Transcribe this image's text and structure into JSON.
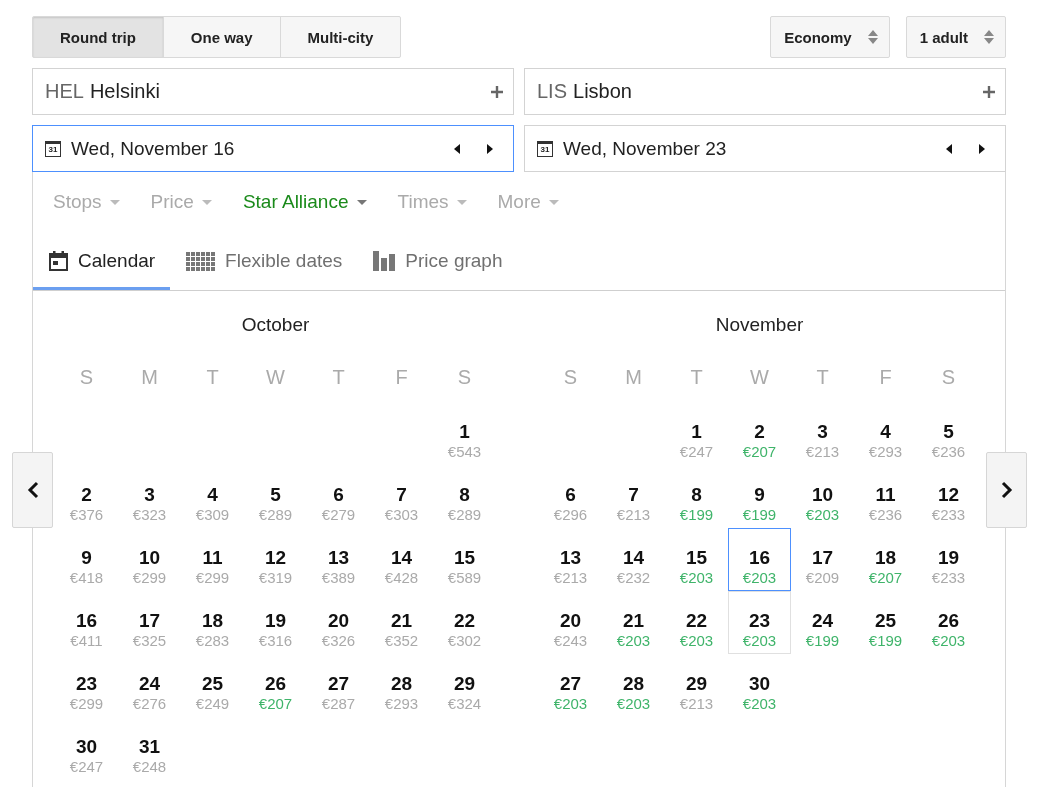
{
  "trip_types": [
    {
      "label": "Round trip",
      "selected": true
    },
    {
      "label": "One way",
      "selected": false
    },
    {
      "label": "Multi-city",
      "selected": false
    }
  ],
  "cabin": {
    "value": "Economy"
  },
  "passengers": {
    "value": "1 adult"
  },
  "origin": {
    "code": "HEL",
    "city": "Helsinki"
  },
  "destination": {
    "code": "LIS",
    "city": "Lisbon"
  },
  "dates": [
    {
      "icon_label": "31",
      "value": "Wed, November 16",
      "focused": true
    },
    {
      "icon_label": "31",
      "value": "Wed, November 23",
      "focused": false
    }
  ],
  "filters": [
    {
      "label": "Stops",
      "active": false
    },
    {
      "label": "Price",
      "active": false
    },
    {
      "label": "Star Alliance",
      "active": true
    },
    {
      "label": "Times",
      "active": false
    },
    {
      "label": "More",
      "active": false
    }
  ],
  "view_tabs": [
    {
      "label": "Calendar",
      "selected": true
    },
    {
      "label": "Flexible dates",
      "selected": false
    },
    {
      "label": "Price graph",
      "selected": false
    }
  ],
  "calendar": {
    "months": [
      {
        "name": "October",
        "weekdays": [
          "S",
          "M",
          "T",
          "W",
          "T",
          "F",
          "S"
        ],
        "weeks": [
          [
            {
              "day": "1",
              "price": "€543",
              "cheap": false,
              "selected": false,
              "return_date": false
            }
          ],
          [
            {
              "day": "2",
              "price": "€376",
              "cheap": false,
              "selected": false,
              "return_date": false
            },
            {
              "day": "3",
              "price": "€323",
              "cheap": false,
              "selected": false,
              "return_date": false
            },
            {
              "day": "4",
              "price": "€309",
              "cheap": false,
              "selected": false,
              "return_date": false
            },
            {
              "day": "5",
              "price": "€289",
              "cheap": false,
              "selected": false,
              "return_date": false
            },
            {
              "day": "6",
              "price": "€279",
              "cheap": false,
              "selected": false,
              "return_date": false
            },
            {
              "day": "7",
              "price": "€303",
              "cheap": false,
              "selected": false,
              "return_date": false
            },
            {
              "day": "8",
              "price": "€289",
              "cheap": false,
              "selected": false,
              "return_date": false
            }
          ],
          [
            {
              "day": "9",
              "price": "€418",
              "cheap": false,
              "selected": false,
              "return_date": false
            },
            {
              "day": "10",
              "price": "€299",
              "cheap": false,
              "selected": false,
              "return_date": false
            },
            {
              "day": "11",
              "price": "€299",
              "cheap": false,
              "selected": false,
              "return_date": false
            },
            {
              "day": "12",
              "price": "€319",
              "cheap": false,
              "selected": false,
              "return_date": false
            },
            {
              "day": "13",
              "price": "€389",
              "cheap": false,
              "selected": false,
              "return_date": false
            },
            {
              "day": "14",
              "price": "€428",
              "cheap": false,
              "selected": false,
              "return_date": false
            },
            {
              "day": "15",
              "price": "€589",
              "cheap": false,
              "selected": false,
              "return_date": false
            }
          ],
          [
            {
              "day": "16",
              "price": "€411",
              "cheap": false,
              "selected": false,
              "return_date": false
            },
            {
              "day": "17",
              "price": "€325",
              "cheap": false,
              "selected": false,
              "return_date": false
            },
            {
              "day": "18",
              "price": "€283",
              "cheap": false,
              "selected": false,
              "return_date": false
            },
            {
              "day": "19",
              "price": "€316",
              "cheap": false,
              "selected": false,
              "return_date": false
            },
            {
              "day": "20",
              "price": "€326",
              "cheap": false,
              "selected": false,
              "return_date": false
            },
            {
              "day": "21",
              "price": "€352",
              "cheap": false,
              "selected": false,
              "return_date": false
            },
            {
              "day": "22",
              "price": "€302",
              "cheap": false,
              "selected": false,
              "return_date": false
            }
          ],
          [
            {
              "day": "23",
              "price": "€299",
              "cheap": false,
              "selected": false,
              "return_date": false
            },
            {
              "day": "24",
              "price": "€276",
              "cheap": false,
              "selected": false,
              "return_date": false
            },
            {
              "day": "25",
              "price": "€249",
              "cheap": false,
              "selected": false,
              "return_date": false
            },
            {
              "day": "26",
              "price": "€207",
              "cheap": true,
              "selected": false,
              "return_date": false
            },
            {
              "day": "27",
              "price": "€287",
              "cheap": false,
              "selected": false,
              "return_date": false
            },
            {
              "day": "28",
              "price": "€293",
              "cheap": false,
              "selected": false,
              "return_date": false
            },
            {
              "day": "29",
              "price": "€324",
              "cheap": false,
              "selected": false,
              "return_date": false
            }
          ],
          [
            {
              "day": "30",
              "price": "€247",
              "cheap": false,
              "selected": false,
              "return_date": false
            },
            {
              "day": "31",
              "price": "€248",
              "cheap": false,
              "selected": false,
              "return_date": false
            }
          ]
        ]
      },
      {
        "name": "November",
        "weekdays": [
          "S",
          "M",
          "T",
          "W",
          "T",
          "F",
          "S"
        ],
        "weeks": [
          [
            {
              "day": "1",
              "price": "€247",
              "cheap": false,
              "selected": false,
              "return_date": false
            },
            {
              "day": "2",
              "price": "€207",
              "cheap": true,
              "selected": false,
              "return_date": false
            },
            {
              "day": "3",
              "price": "€213",
              "cheap": false,
              "selected": false,
              "return_date": false
            },
            {
              "day": "4",
              "price": "€293",
              "cheap": false,
              "selected": false,
              "return_date": false
            },
            {
              "day": "5",
              "price": "€236",
              "cheap": false,
              "selected": false,
              "return_date": false
            }
          ],
          [
            {
              "day": "6",
              "price": "€296",
              "cheap": false,
              "selected": false,
              "return_date": false
            },
            {
              "day": "7",
              "price": "€213",
              "cheap": false,
              "selected": false,
              "return_date": false
            },
            {
              "day": "8",
              "price": "€199",
              "cheap": true,
              "selected": false,
              "return_date": false
            },
            {
              "day": "9",
              "price": "€199",
              "cheap": true,
              "selected": false,
              "return_date": false
            },
            {
              "day": "10",
              "price": "€203",
              "cheap": true,
              "selected": false,
              "return_date": false
            },
            {
              "day": "11",
              "price": "€236",
              "cheap": false,
              "selected": false,
              "return_date": false
            },
            {
              "day": "12",
              "price": "€233",
              "cheap": false,
              "selected": false,
              "return_date": false
            }
          ],
          [
            {
              "day": "13",
              "price": "€213",
              "cheap": false,
              "selected": false,
              "return_date": false
            },
            {
              "day": "14",
              "price": "€232",
              "cheap": false,
              "selected": false,
              "return_date": false
            },
            {
              "day": "15",
              "price": "€203",
              "cheap": true,
              "selected": false,
              "return_date": false
            },
            {
              "day": "16",
              "price": "€203",
              "cheap": true,
              "selected": true,
              "return_date": false
            },
            {
              "day": "17",
              "price": "€209",
              "cheap": false,
              "selected": false,
              "return_date": false
            },
            {
              "day": "18",
              "price": "€207",
              "cheap": true,
              "selected": false,
              "return_date": false
            },
            {
              "day": "19",
              "price": "€233",
              "cheap": false,
              "selected": false,
              "return_date": false
            }
          ],
          [
            {
              "day": "20",
              "price": "€243",
              "cheap": false,
              "selected": false,
              "return_date": false
            },
            {
              "day": "21",
              "price": "€203",
              "cheap": true,
              "selected": false,
              "return_date": false
            },
            {
              "day": "22",
              "price": "€203",
              "cheap": true,
              "selected": false,
              "return_date": false
            },
            {
              "day": "23",
              "price": "€203",
              "cheap": true,
              "selected": false,
              "return_date": true
            },
            {
              "day": "24",
              "price": "€199",
              "cheap": true,
              "selected": false,
              "return_date": false
            },
            {
              "day": "25",
              "price": "€199",
              "cheap": true,
              "selected": false,
              "return_date": false
            },
            {
              "day": "26",
              "price": "€203",
              "cheap": true,
              "selected": false,
              "return_date": false
            }
          ],
          [
            {
              "day": "27",
              "price": "€203",
              "cheap": true,
              "selected": false,
              "return_date": false
            },
            {
              "day": "28",
              "price": "€203",
              "cheap": true,
              "selected": false,
              "return_date": false
            },
            {
              "day": "29",
              "price": "€213",
              "cheap": false,
              "selected": false,
              "return_date": false
            },
            {
              "day": "30",
              "price": "€203",
              "cheap": true,
              "selected": false,
              "return_date": false
            }
          ]
        ]
      }
    ]
  }
}
